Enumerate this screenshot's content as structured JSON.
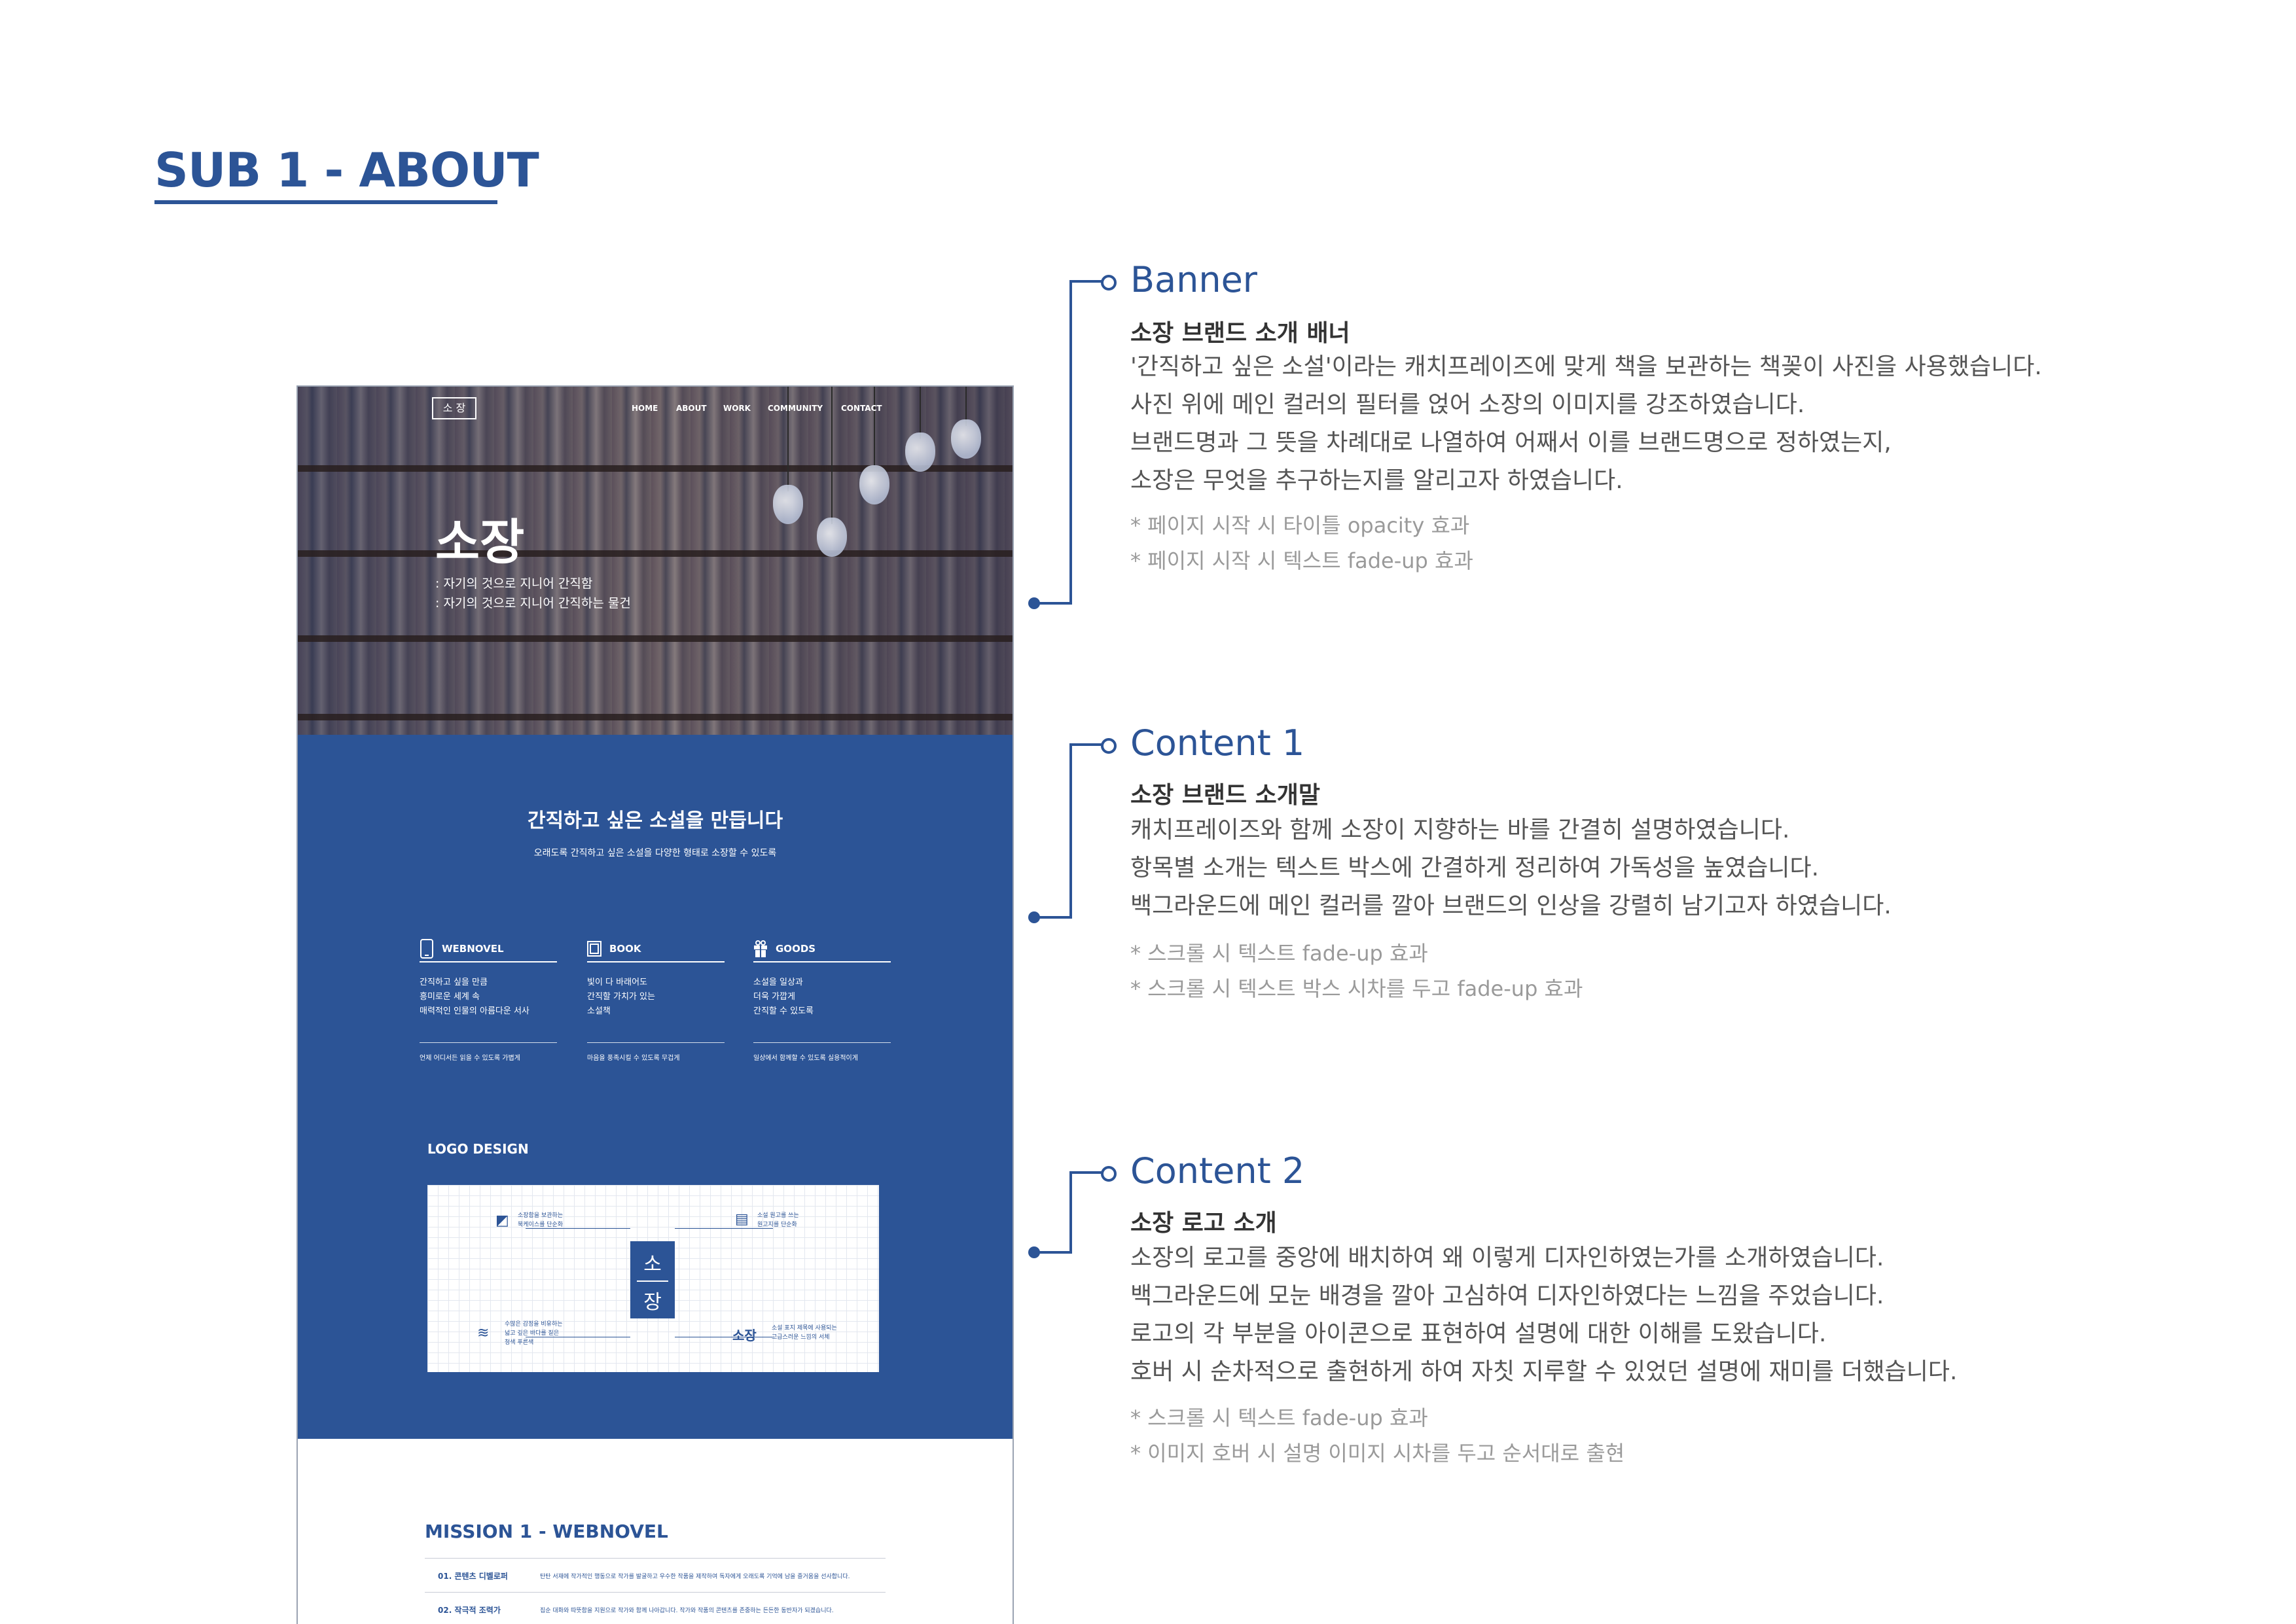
{
  "page": {
    "title": "SUB 1 - ABOUT"
  },
  "colors": {
    "brand_blue": "#2c5496",
    "body_text": "#555555",
    "note_text": "#9a9a9a"
  },
  "mockup": {
    "nav": {
      "logo": "소 장",
      "items": [
        "HOME",
        "ABOUT",
        "WORK",
        "COMMUNITY",
        "CONTACT"
      ]
    },
    "banner": {
      "title": "소장",
      "lines": [
        ": 자기의 것으로 지니어 간직함",
        ": 자기의 것으로 지니어 간직하는 물건"
      ]
    },
    "content1": {
      "heading": "간직하고 싶은 소설을 만듭니다",
      "subheading": "오래도록 간직하고 싶은 소설을 다양한 형태로 소장할 수 있도록",
      "columns": [
        {
          "icon": "phone-icon",
          "title": "WEBNOVEL",
          "lines": [
            "간직하고 싶을 만큼",
            "흥미로운 세계 속",
            "매력적인 인물의 아름다운 서사"
          ],
          "footer": "언제 어디서든 읽을 수 있도록 가볍게"
        },
        {
          "icon": "book-icon",
          "title": "BOOK",
          "lines": [
            "빛이 다 바래어도",
            "간직할 가치가 있는",
            "소설책"
          ],
          "footer": "마음을 풍족시킬 수 있도록 무겁게"
        },
        {
          "icon": "gift-icon",
          "title": "GOODS",
          "lines": [
            "소설을 일상과",
            "더욱 가깝게",
            "간직할 수 있도록"
          ],
          "footer": "일상에서 함께할 수 있도록 실용적이게"
        }
      ]
    },
    "logo_design": {
      "label": "LOGO DESIGN",
      "mark_top": "소",
      "mark_bottom": "장",
      "notes": [
        {
          "icon": "book-corner-icon",
          "lines": [
            "소장함을 보관하는",
            "북케이스를 단순화"
          ]
        },
        {
          "icon": "bookmark-icon",
          "lines": [
            "소설 원고를 쓰는",
            "원고지를 단순화"
          ]
        },
        {
          "icon": "wave-icon",
          "lines": [
            "수많은 감정을 비유하는",
            "넓고 깊은 바다를 짙은",
            "청색 푸른색"
          ]
        },
        {
          "icon": "wordmark-icon",
          "word": "소장",
          "lines": [
            "소설 표지 제목에 사용되는",
            "고급스러운 느낌의 서체"
          ]
        }
      ]
    },
    "mission": {
      "title": "MISSION 1 - WEBNOVEL",
      "rows": [
        {
          "label": "01. 콘텐츠 디벨로퍼",
          "desc": "탄탄 서재에 작가적인 행동으로 작가를 발굴하고 우수한 작품을 제작하여 독자에게 오래도록 기억에 남을 즐거움을 선사합니다."
        },
        {
          "label": "02. 작극적 조력가",
          "desc": "집순 대화와 따뜻함을 지원으로 작가와 함께 나아갑니다. 작가와 작품의 콘텐츠를 존중하는 든든한 동반자가 되겠습니다."
        }
      ]
    }
  },
  "annotations": [
    {
      "title": "Banner",
      "subtitle": "소장 브랜드 소개 배너",
      "body": [
        "'간직하고 싶은 소설'이라는 캐치프레이즈에 맞게 책을 보관하는 책꽂이 사진을 사용했습니다.",
        "사진 위에 메인 컬러의 필터를 얹어 소장의 이미지를 강조하였습니다.",
        "브랜드명과 그 뜻을 차례대로 나열하여 어째서 이를 브랜드명으로 정하였는지,",
        "소장은 무엇을 추구하는지를 알리고자 하였습니다."
      ],
      "notes": [
        "* 페이지 시작 시 타이틀 opacity 효과",
        "* 페이지 시작 시 텍스트 fade-up 효과"
      ]
    },
    {
      "title": "Content 1",
      "subtitle": "소장 브랜드 소개말",
      "body": [
        "캐치프레이즈와 함께 소장이 지향하는 바를 간결히 설명하였습니다.",
        "항목별 소개는 텍스트 박스에 간결하게 정리하여 가독성을 높였습니다.",
        "백그라운드에 메인 컬러를 깔아 브랜드의 인상을 강렬히 남기고자 하였습니다."
      ],
      "notes": [
        "* 스크롤 시 텍스트 fade-up 효과",
        "* 스크롤 시 텍스트 박스 시차를 두고 fade-up 효과"
      ]
    },
    {
      "title": "Content 2",
      "subtitle": "소장 로고 소개",
      "body": [
        "소장의 로고를 중앙에 배치하여 왜 이렇게 디자인하였는가를 소개하였습니다.",
        "백그라운드에 모눈 배경을 깔아 고심하여 디자인하였다는 느낌을 주었습니다.",
        "로고의 각 부분을 아이콘으로 표현하여 설명에 대한 이해를 도왔습니다.",
        "호버 시 순차적으로 출현하게 하여 자칫 지루할 수 있었던 설명에 재미를 더했습니다."
      ],
      "notes": [
        "* 스크롤 시 텍스트 fade-up 효과",
        "* 이미지 호버 시 설명 이미지 시차를 두고 순서대로 출현"
      ]
    }
  ]
}
